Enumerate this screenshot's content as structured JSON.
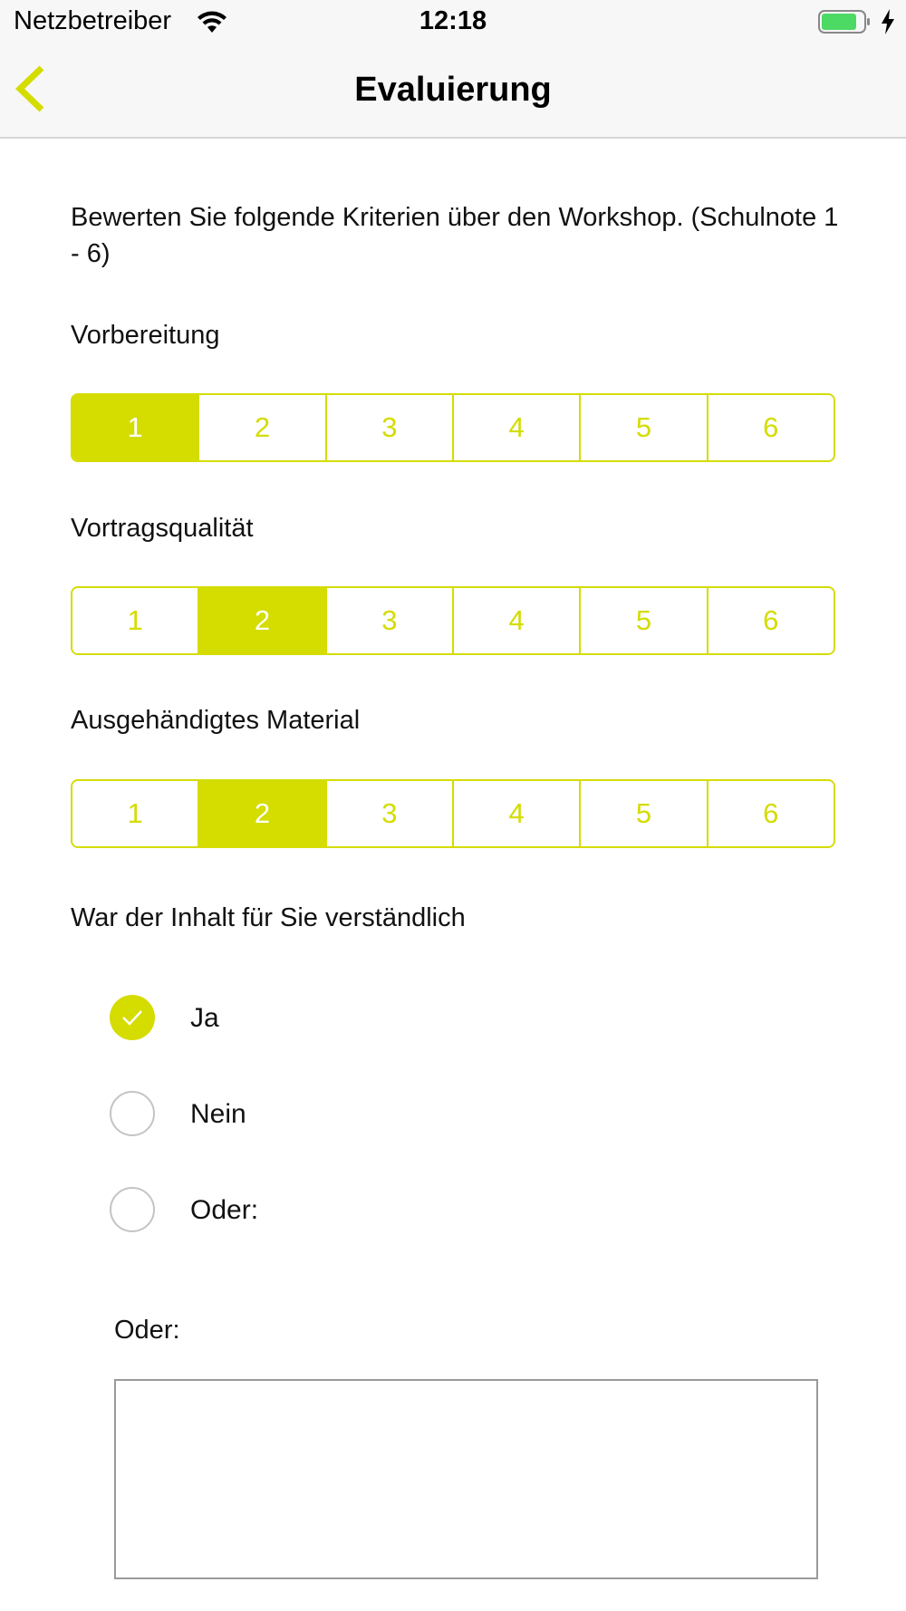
{
  "status_bar": {
    "carrier": "Netzbetreiber",
    "time": "12:18",
    "battery_color": "#4cd964"
  },
  "nav": {
    "title": "Evaluierung",
    "back_icon": "chevron-left-icon"
  },
  "intro": "Bewerten Sie folgende Kriterien über den Workshop. (Schulnote 1 - 6)",
  "accent_color": "#d4dc00",
  "ratings": [
    {
      "label": "Vorbereitung",
      "options": [
        "1",
        "2",
        "3",
        "4",
        "5",
        "6"
      ],
      "selected": "1"
    },
    {
      "label": "Vortragsqualität",
      "options": [
        "1",
        "2",
        "3",
        "4",
        "5",
        "6"
      ],
      "selected": "2"
    },
    {
      "label": "Ausgehändigtes Material",
      "options": [
        "1",
        "2",
        "3",
        "4",
        "5",
        "6"
      ],
      "selected": "2"
    }
  ],
  "question": {
    "label": "War der Inhalt für Sie verständlich",
    "options": [
      {
        "label": "Ja",
        "checked": true
      },
      {
        "label": "Nein",
        "checked": false
      },
      {
        "label": "Oder:",
        "checked": false
      }
    ]
  },
  "other": {
    "label": "Oder:",
    "value": ""
  }
}
